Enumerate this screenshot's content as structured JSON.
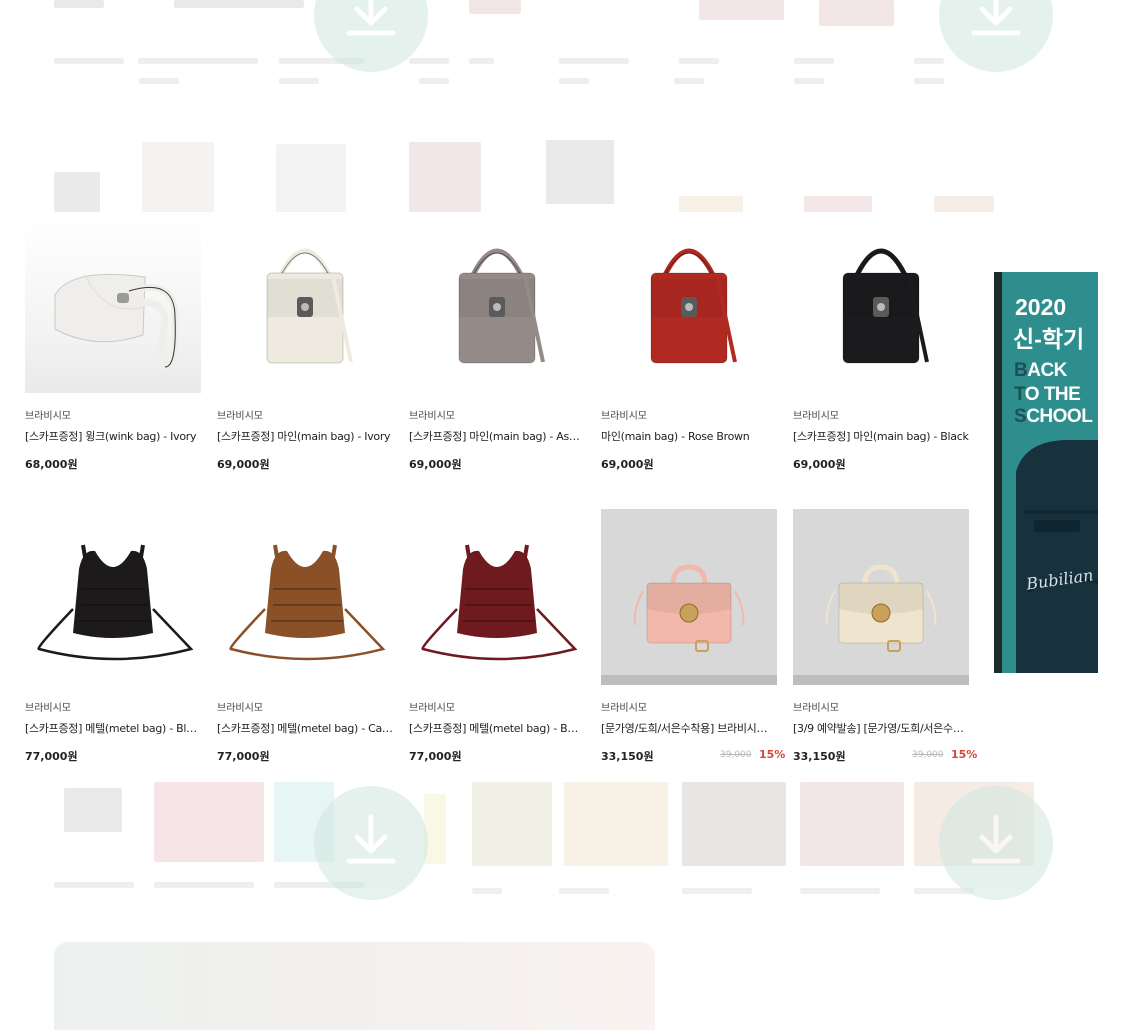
{
  "colors": {
    "accent_discount": "#d7443a",
    "ad_background": "#2e8e8e",
    "text_main": "#222222",
    "text_strike": "#b8b8b8"
  },
  "icons": {
    "download": "download-arrow-icon"
  },
  "products": [
    {
      "brand": "브라비시모",
      "name": "[스카프증정] 윙크(wink bag) - Ivory",
      "price": "68,000원",
      "bag_color": "#efeeea",
      "style": "wink"
    },
    {
      "brand": "브라비시모",
      "name": "[스카프증정] 마인(main bag) - Ivory",
      "price": "69,000원",
      "bag_color": "#eeeae0",
      "style": "main"
    },
    {
      "brand": "브라비시모",
      "name": "[스카프증정] 마인(main bag) - Ash …",
      "price": "69,000원",
      "bag_color": "#948a87",
      "style": "main"
    },
    {
      "brand": "브라비시모",
      "name": "마인(main bag) - Rose Brown",
      "price": "69,000원",
      "bag_color": "#b02a22",
      "style": "main"
    },
    {
      "brand": "브라비시모",
      "name": "[스카프증정] 마인(main bag) - Black",
      "price": "69,000원",
      "bag_color": "#1b1b1d",
      "style": "main"
    },
    {
      "brand": "브라비시모",
      "name": "[스카프증정] 메텔(metel bag) - Black",
      "price": "77,000원",
      "bag_color": "#1c1a1b",
      "style": "metel"
    },
    {
      "brand": "브라비시모",
      "name": "[스카프증정] 메텔(metel bag) - Cara…",
      "price": "77,000원",
      "bag_color": "#8a5128",
      "style": "metel"
    },
    {
      "brand": "브라비시모",
      "name": "[스카프증정] 메텔(metel bag) - Burg…",
      "price": "77,000원",
      "bag_color": "#6e1a1f",
      "style": "metel"
    },
    {
      "brand": "브라비시모",
      "name": "[문가영/도희/서은수착용] 브라비시모 …",
      "price": "33,150원",
      "original_price": "39,000",
      "discount": "15%",
      "bag_color": "#f2b8ab",
      "style": "mini"
    },
    {
      "brand": "브라비시모",
      "name": "[3/9 예약발송] [문가영/도희/서은수착…",
      "price": "33,150원",
      "original_price": "39,000",
      "discount": "15%",
      "bag_color": "#efe4cd",
      "style": "mini"
    }
  ],
  "side_ad": {
    "year": "2020",
    "title": "신-학기",
    "lines": [
      {
        "first": "B",
        "rest": "ACK"
      },
      {
        "first": "T",
        "rest": "O THE"
      },
      {
        "first": "S",
        "rest": "CHOOL"
      }
    ],
    "brand": "Bubilian"
  }
}
